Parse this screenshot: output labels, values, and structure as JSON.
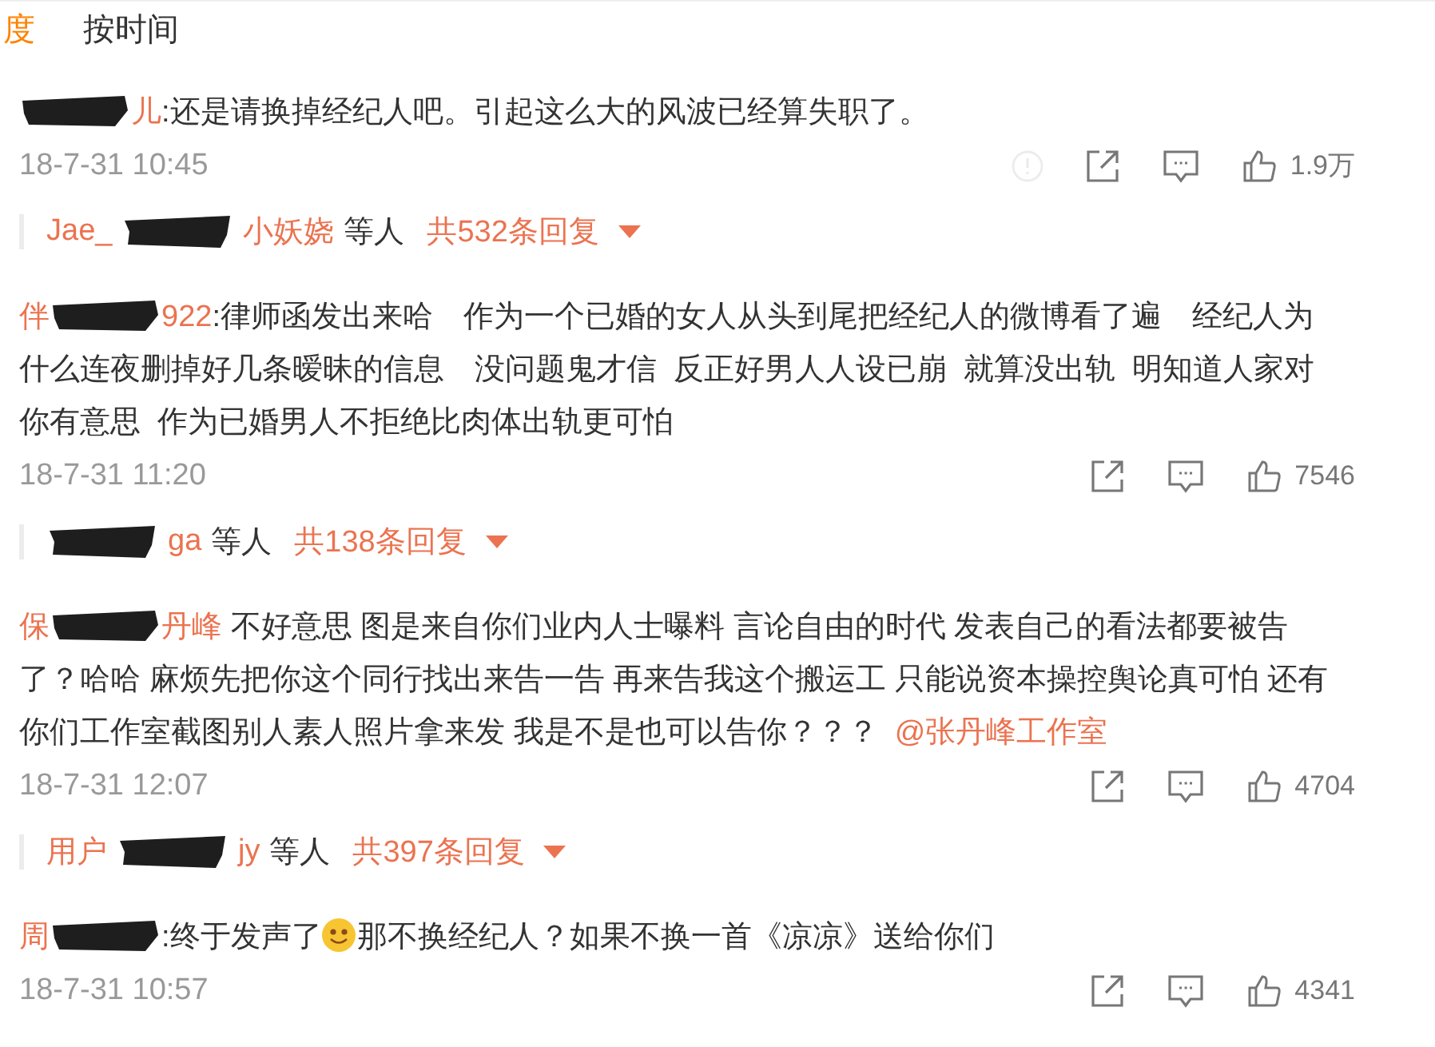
{
  "tabs": [
    {
      "label": "度",
      "selected": true
    },
    {
      "label": "按时间",
      "selected": false
    }
  ],
  "comments": [
    {
      "author": [
        {
          "kind": "redacted"
        },
        {
          "kind": "text",
          "text": "儿"
        }
      ],
      "body": [
        {
          "kind": "text",
          "text": ":还是请换掉经纪人吧。引起这么大的风波已经算失职了。"
        }
      ],
      "time": "18-7-31 10:45",
      "report_icon": true,
      "likes": "1.9万",
      "replies": {
        "names": [
          {
            "kind": "text",
            "text": "Jae_"
          },
          {
            "kind": "redacted"
          },
          {
            "kind": "text",
            "text": "小妖娆"
          }
        ],
        "others": "等人",
        "count": "共532条回复"
      }
    },
    {
      "author": [
        {
          "kind": "text",
          "text": "伴"
        },
        {
          "kind": "redacted"
        },
        {
          "kind": "text",
          "text": "922"
        }
      ],
      "body": [
        {
          "kind": "text",
          "text": ":律师函发出来哈　作为一个已婚的女人从头到尾把经纪人的微博看了遍　经纪人为什么连夜删掉好几条暧昧的信息　没问题鬼才信  反正好男人人设已崩  就算没出轨  明知道人家对你有意思  作为已婚男人不拒绝比肉体出轨更可怕"
        }
      ],
      "time": "18-7-31 11:20",
      "report_icon": false,
      "likes": "7546",
      "replies": {
        "names": [
          {
            "kind": "redacted"
          },
          {
            "kind": "text",
            "text": "ga"
          }
        ],
        "others": "等人",
        "count": "共138条回复"
      }
    },
    {
      "author": [
        {
          "kind": "text",
          "text": "保"
        },
        {
          "kind": "redacted"
        },
        {
          "kind": "text",
          "text": "丹峰"
        }
      ],
      "body": [
        {
          "kind": "text",
          "text": " 不好意思 图是来自你们业内人士曝料 言论自由的时代 发表自己的看法都要被告了？哈哈 麻烦先把你这个同行找出来告一告 再来告我这个搬运工 只能说资本操控舆论真可怕 还有你们工作室截图别人素人照片拿来发 我是不是也可以告你？？？  "
        },
        {
          "kind": "link",
          "text": "@张丹峰工作室"
        }
      ],
      "time": "18-7-31 12:07",
      "report_icon": false,
      "likes": "4704",
      "replies": {
        "names": [
          {
            "kind": "text",
            "text": "用户"
          },
          {
            "kind": "redacted"
          },
          {
            "kind": "text",
            "text": "jy"
          }
        ],
        "others": "等人",
        "count": "共397条回复"
      }
    },
    {
      "author": [
        {
          "kind": "text",
          "text": "周"
        },
        {
          "kind": "redacted"
        }
      ],
      "body": [
        {
          "kind": "text",
          "text": ":终于发声了"
        },
        {
          "kind": "emoji"
        },
        {
          "kind": "text",
          "text": "那不换经纪人？如果不换一首《凉凉》送给你们"
        }
      ],
      "time": "18-7-31 10:57",
      "report_icon": false,
      "likes": "4341"
    }
  ]
}
